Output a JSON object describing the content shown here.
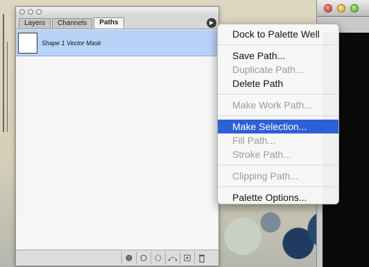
{
  "palette": {
    "tabs": [
      {
        "label": "Layers"
      },
      {
        "label": "Channels"
      },
      {
        "label": "Paths"
      }
    ],
    "path_rows": [
      {
        "label": "Shape 1 Vector Mask"
      }
    ],
    "bottom_tools": [
      "fill-path-icon",
      "stroke-path-icon",
      "load-selection-icon",
      "make-work-path-icon",
      "new-path-icon",
      "trash-icon"
    ]
  },
  "menu": {
    "groups": [
      [
        {
          "label": "Dock to Palette Well",
          "enabled": true
        }
      ],
      [
        {
          "label": "Save Path...",
          "enabled": true
        },
        {
          "label": "Duplicate Path...",
          "enabled": false
        },
        {
          "label": "Delete Path",
          "enabled": true
        }
      ],
      [
        {
          "label": "Make Work Path...",
          "enabled": false
        }
      ],
      [
        {
          "label": "Make Selection...",
          "enabled": true,
          "highlighted": true
        },
        {
          "label": "Fill Path...",
          "enabled": false
        },
        {
          "label": "Stroke Path...",
          "enabled": false
        }
      ],
      [
        {
          "label": "Clipping Path...",
          "enabled": false
        }
      ],
      [
        {
          "label": "Palette Options...",
          "enabled": true
        }
      ]
    ]
  },
  "colors": {
    "selection_row": "#b9d2f8",
    "menu_highlight": "#2f5fd6"
  }
}
